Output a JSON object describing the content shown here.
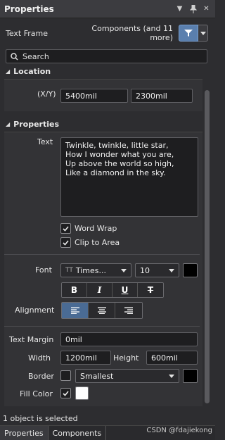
{
  "header": {
    "title": "Properties"
  },
  "frame_row": {
    "label": "Text Frame",
    "components": "Components (and 11 more)"
  },
  "search": {
    "placeholder": "Search"
  },
  "location": {
    "section": "Location",
    "xy_label": "(X/Y)",
    "x": "5400mil",
    "y": "2300mil"
  },
  "properties": {
    "section": "Properties",
    "text_label": "Text",
    "text_value": "Twinkle, twinkle, little star,\nHow I wonder what you are,\nUp above the world so high,\nLike a diamond in the sky.",
    "word_wrap": "Word Wrap",
    "clip_to_area": "Clip to Area",
    "font_label": "Font",
    "font_name": "Times...",
    "font_size": "10",
    "font_color": "#000000",
    "format_buttons": [
      "B",
      "I",
      "U",
      "T"
    ],
    "alignment_label": "Alignment",
    "text_margin_label": "Text Margin",
    "text_margin": "0mil",
    "width_label": "Width",
    "width": "1200mil",
    "height_label": "Height",
    "height": "600mil",
    "border_label": "Border",
    "border_style": "Smallest",
    "border_color": "#000000",
    "fill_color_label": "Fill Color",
    "fill_color": "#ffffff"
  },
  "status": {
    "text": "1 object is selected"
  },
  "tabs": [
    "Properties",
    "Components"
  ],
  "watermark": "CSDN @fdajiekong"
}
